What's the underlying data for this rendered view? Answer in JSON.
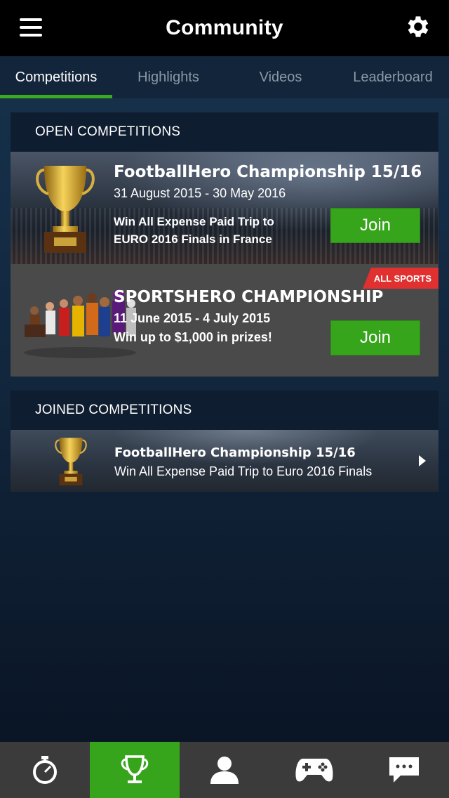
{
  "header": {
    "title": "Community",
    "menu_icon": "hamburger-menu-icon",
    "settings_icon": "gear-icon"
  },
  "tabs": [
    {
      "label": "Competitions",
      "active": true
    },
    {
      "label": "Highlights",
      "active": false
    },
    {
      "label": "Videos",
      "active": false
    },
    {
      "label": "Leaderboard",
      "active": false
    }
  ],
  "open_competitions": {
    "heading": "OPEN COMPETITIONS",
    "items": [
      {
        "title": "FootballHero Championship 15/16",
        "dates": "31 August 2015 - 30 May 2016",
        "prize_line1": "Win All Expense Paid Trip to",
        "prize_line2": "EURO 2016 Finals in France",
        "join_label": "Join",
        "icon": "trophy-icon"
      },
      {
        "title": "SPORTSHERO CHAMPIONSHIP",
        "dates": "11 June 2015 - 4 July 2015",
        "prize": "Win up to $1,000 in prizes!",
        "join_label": "Join",
        "badge": "ALL SPORTS",
        "icon": "athletes-image"
      }
    ]
  },
  "joined_competitions": {
    "heading": "JOINED COMPETITIONS",
    "items": [
      {
        "title": "FootballHero Championship 15/16",
        "subtitle": "Win All Expense Paid Trip to Euro 2016 Finals",
        "icon": "trophy-icon"
      }
    ]
  },
  "bottom_nav": [
    {
      "icon": "stopwatch-icon",
      "active": false
    },
    {
      "icon": "trophy-icon",
      "active": true
    },
    {
      "icon": "user-icon",
      "active": false
    },
    {
      "icon": "gamepad-icon",
      "active": false
    },
    {
      "icon": "chat-icon",
      "active": false
    }
  ],
  "colors": {
    "accent_green": "#37a51c",
    "badge_red": "#e03030",
    "header_bg": "#000000"
  }
}
